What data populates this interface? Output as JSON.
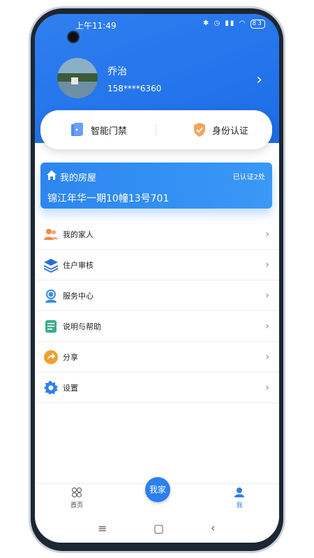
{
  "status_bar": {
    "time": "上午11:49",
    "battery": "83"
  },
  "profile": {
    "name": "乔治",
    "phone": "158****6360"
  },
  "quick_actions": [
    {
      "label": "智能门禁",
      "icon": "door-access-icon",
      "color": "#4f8df5"
    },
    {
      "label": "身份认证",
      "icon": "shield-check-icon",
      "color": "#f5a35a"
    }
  ],
  "house": {
    "title": "我的房屋",
    "certified": "已认证2处",
    "address": "锦江年华一期10幢13号701"
  },
  "menu": [
    {
      "label": "我的家人",
      "icon": "family-icon",
      "color": "#f08a4b"
    },
    {
      "label": "住户审核",
      "icon": "layers-icon",
      "color": "#2b6fd6"
    },
    {
      "label": "服务中心",
      "icon": "customer-service-icon",
      "color": "#3a8ee6"
    },
    {
      "label": "说明与帮助",
      "icon": "document-icon",
      "color": "#3cae8c"
    },
    {
      "label": "分享",
      "icon": "share-icon",
      "color": "#f0a030"
    },
    {
      "label": "设置",
      "icon": "settings-icon",
      "color": "#2f7ff0"
    }
  ],
  "tabbar": {
    "home": "首页",
    "center": "我家",
    "me": "我",
    "active_color": "#2b7ff0"
  }
}
